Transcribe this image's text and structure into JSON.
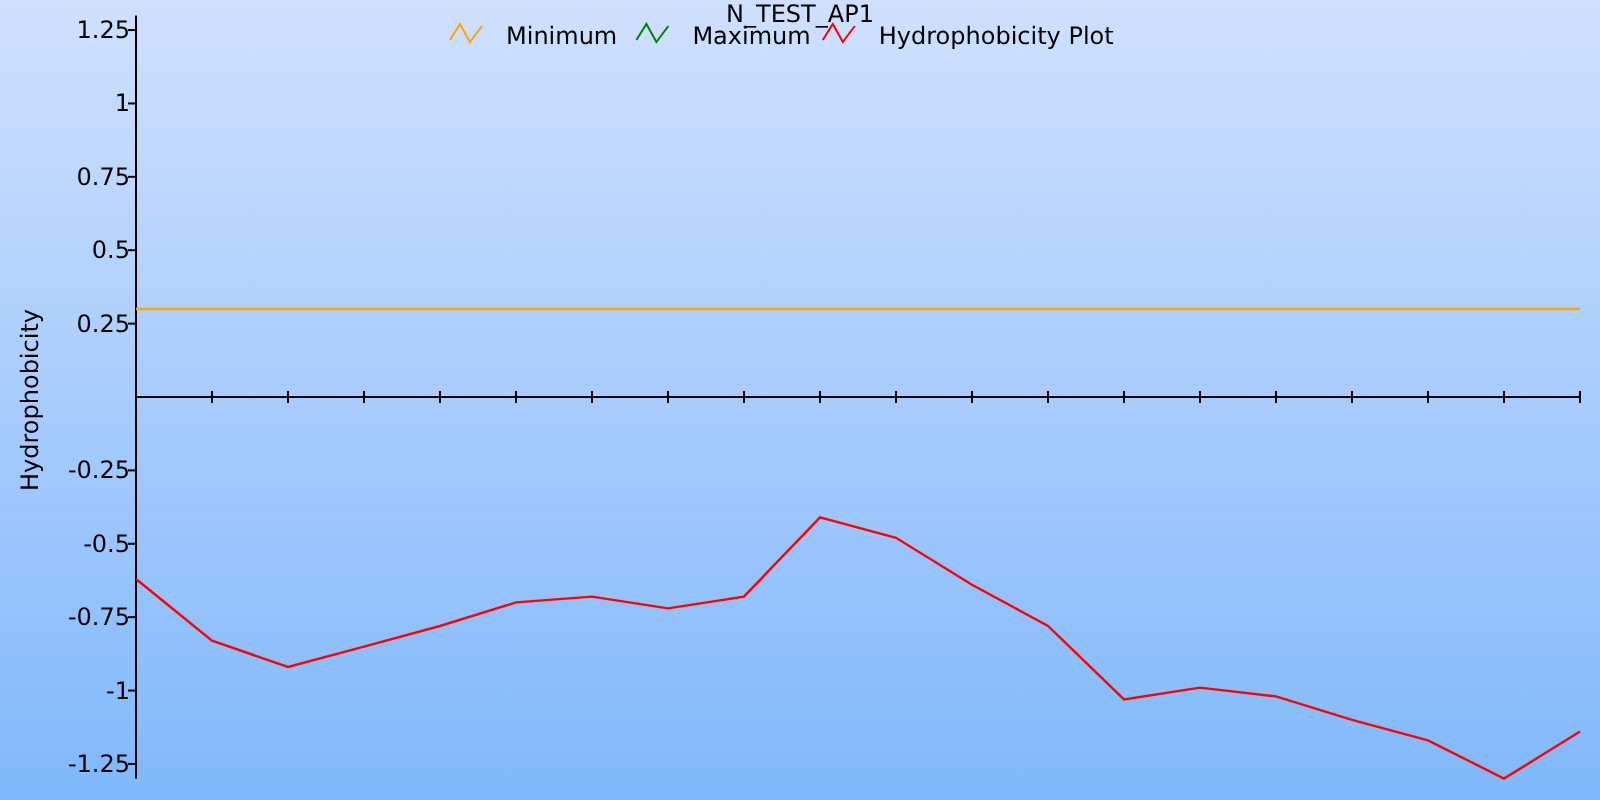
{
  "chart_data": {
    "type": "line",
    "title": "N_TEST_AP1",
    "ylabel": "Hydrophobicity",
    "categories": [
      null,
      null,
      null,
      null,
      null,
      null,
      null,
      null,
      null,
      null,
      null,
      null,
      null,
      null,
      null,
      null,
      null,
      null,
      null,
      null
    ],
    "ylim": [
      -1.3,
      1.3
    ],
    "legend": true,
    "yticks": [
      -1.25,
      -1,
      -0.75,
      -0.5,
      -0.25,
      0.25,
      0.5,
      0.75,
      1,
      1.25
    ],
    "series": [
      {
        "name": "Minimum",
        "color": "#ffa500",
        "values": [
          0.3,
          0.3,
          0.3,
          0.3,
          0.3,
          0.3,
          0.3,
          0.3,
          0.3,
          0.3,
          0.3,
          0.3,
          0.3,
          0.3,
          0.3,
          0.3,
          0.3,
          0.3,
          0.3,
          0.3
        ]
      },
      {
        "name": "Maximum",
        "color": "#008000",
        "values": [
          null,
          null,
          null,
          null,
          null,
          null,
          null,
          null,
          null,
          null,
          null,
          null,
          null,
          null,
          null,
          null,
          null,
          null,
          null,
          null
        ]
      },
      {
        "name": "Hydrophobicity Plot",
        "color": "#ff0000",
        "values": [
          -0.62,
          -0.83,
          -0.92,
          -0.85,
          -0.78,
          -0.7,
          -0.68,
          -0.72,
          -0.68,
          -0.41,
          -0.48,
          -0.64,
          -0.78,
          -1.03,
          -0.99,
          -1.02,
          -1.1,
          -1.17,
          -1.3,
          -1.14
        ]
      }
    ]
  }
}
